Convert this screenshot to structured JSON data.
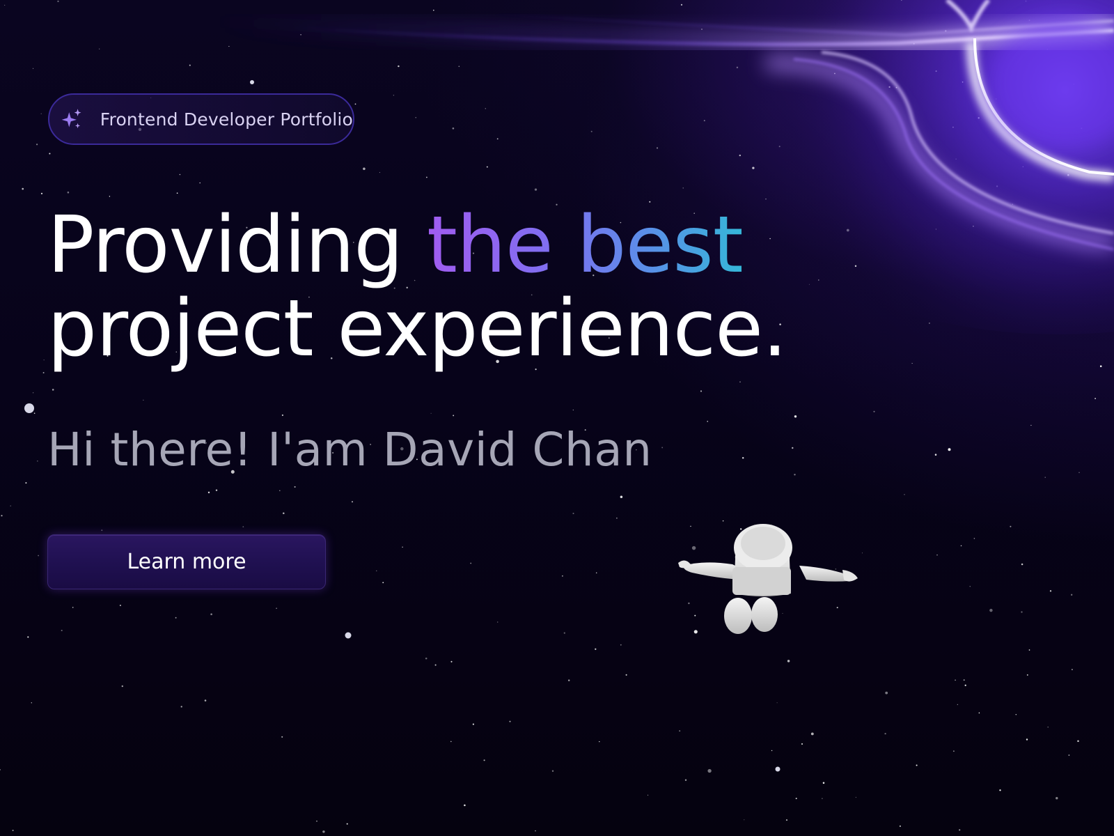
{
  "badge": {
    "icon": "sparkles-icon",
    "label": "Frontend Developer Portfolio"
  },
  "hero": {
    "headline_part1": "Providing ",
    "headline_highlight": "the best",
    "headline_line2": "project experience.",
    "subtitle": "Hi there! I'am David Chan",
    "cta_label": "Learn more"
  },
  "colors": {
    "background": "#05020f",
    "accent_purple": "#a05cf0",
    "accent_blue": "#5a8fe8",
    "accent_cyan": "#35b7d8",
    "button_bg": "#1f1050",
    "badge_border": "#3b2a9a"
  },
  "decor": {
    "background_illustration": "purple black hole accretion ring",
    "figure": "floating astronaut"
  }
}
